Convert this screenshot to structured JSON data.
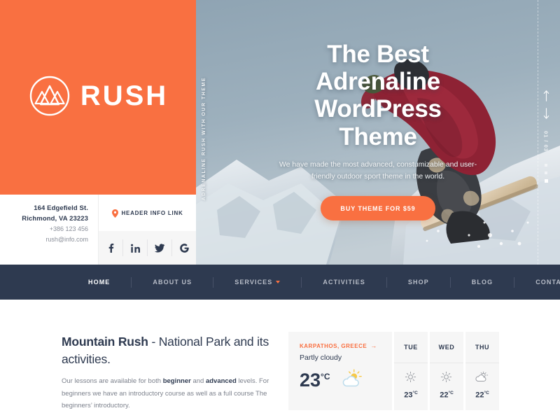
{
  "brand": {
    "name": "RUSH",
    "logo_icon": "mountain-circle-logo",
    "orange": "#f97041",
    "navy": "#2e3a50"
  },
  "contact": {
    "address_line1": "164 Edgefield St.",
    "address_line2": "Richmond, VA 23223",
    "phone": "+386 123 456",
    "email": "rush@info.com"
  },
  "header_info": {
    "pin_icon": "map-pin-icon",
    "label": "HEADER INFO LINK"
  },
  "social": [
    {
      "name": "facebook-icon",
      "label": "f"
    },
    {
      "name": "linkedin-icon",
      "label": "in"
    },
    {
      "name": "twitter-icon",
      "label": "twitter"
    },
    {
      "name": "google-icon",
      "label": "G"
    }
  ],
  "hero": {
    "vertical_text": "ADRENALINE RUSH WITH OUR THEME",
    "title_line1": "The Best",
    "title_line2": "Adrenaline",
    "title_line3": "WordPress",
    "title_line4": "Theme",
    "subtitle": "We have made the most advanced, constumizable and user-friendly outdoor sport theme in the world.",
    "cta_label": "BUY THEME FOR $59",
    "slide_counter": "01 / 03",
    "up_icon": "arrow-up-icon",
    "down_icon": "arrow-down-icon"
  },
  "nav": [
    {
      "label": "HOME",
      "active": true,
      "caret": false
    },
    {
      "label": "ABOUT US",
      "active": false,
      "caret": false
    },
    {
      "label": "SERVICES",
      "active": false,
      "caret": true
    },
    {
      "label": "ACTIVITIES",
      "active": false,
      "caret": false
    },
    {
      "label": "SHOP",
      "active": false,
      "caret": false
    },
    {
      "label": "BLOG",
      "active": false,
      "caret": false
    },
    {
      "label": "CONTACT US",
      "active": false,
      "caret": false
    }
  ],
  "intro": {
    "title_bold": "Mountain Rush",
    "title_rest": " - National Park and its activities.",
    "body_1": "Our lessons are available for both ",
    "body_b1": "beginner",
    "body_2": " and ",
    "body_b2": "advanced",
    "body_3": " levels. For beginners we have an introductory course as well as a full course The beginners’ introductory."
  },
  "weather": {
    "location": "KARPATHOS, GREECE",
    "location_arrow": "→",
    "condition": "Partly cloudy",
    "temperature": "23",
    "unit": "°C",
    "icon": "sun-behind-cloud-icon",
    "forecast": [
      {
        "day": "TUE",
        "icon": "sun-icon",
        "temp": "23",
        "unit": "°C"
      },
      {
        "day": "WED",
        "icon": "sun-icon",
        "temp": "22",
        "unit": "°C"
      },
      {
        "day": "THU",
        "icon": "sun-behind-cloud-icon",
        "temp": "22",
        "unit": "°C"
      }
    ]
  }
}
